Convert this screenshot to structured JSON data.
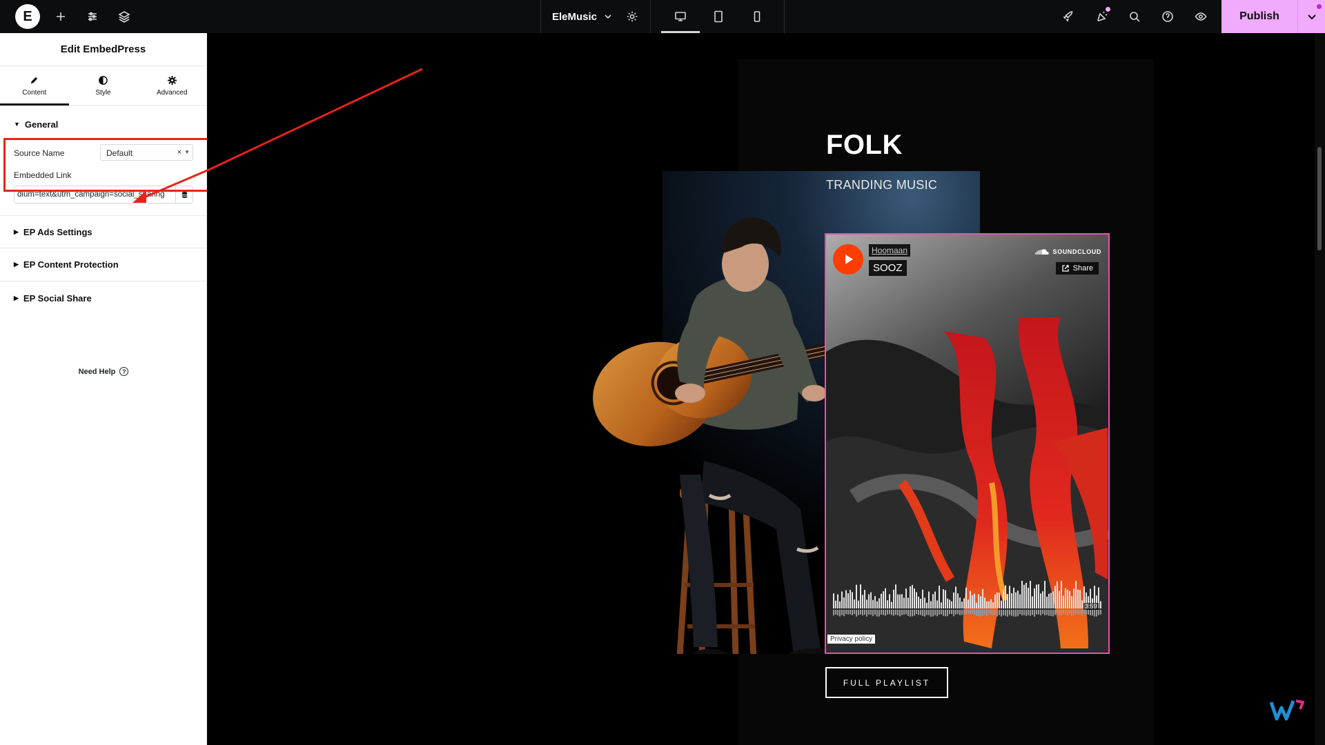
{
  "topbar": {
    "site_title": "EleMusic",
    "publish_label": "Publish",
    "accent_color": "#f0abfc"
  },
  "panel": {
    "title": "Edit EmbedPress",
    "tabs": [
      {
        "label": "Content",
        "icon": "pencil-icon"
      },
      {
        "label": "Style",
        "icon": "half-circle-icon"
      },
      {
        "label": "Advanced",
        "icon": "gear-icon"
      }
    ],
    "general": {
      "heading": "General",
      "source_label": "Source Name",
      "source_value": "Default",
      "embed_label": "Embedded Link",
      "embed_value": "dium=text&utm_campaign=social_sharing"
    },
    "sections": [
      "EP Ads Settings",
      "EP Content Protection",
      "EP Social Share"
    ],
    "need_help": "Need Help"
  },
  "canvas": {
    "heading": "FOLK",
    "subheading": "TRANDING MUSIC",
    "player": {
      "artist": "Hoomaan",
      "track": "SOOZ",
      "brand": "SOUNDCLOUD",
      "share_label": "Share",
      "duration": "3:59",
      "privacy": "Privacy policy"
    },
    "button_label": "FULL PLAYLIST"
  },
  "annotation_color": "#e8231a"
}
